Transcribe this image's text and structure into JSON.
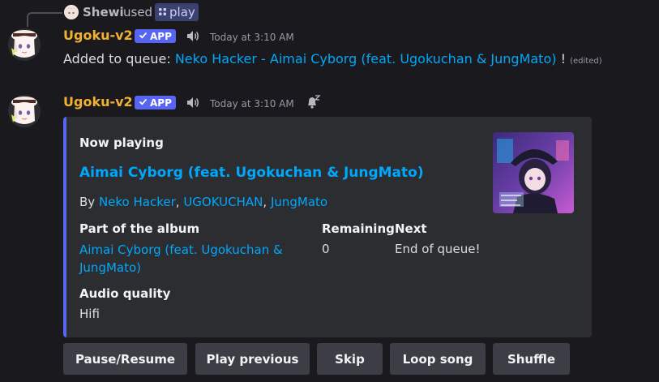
{
  "reply": {
    "user": "Shewi",
    "used_text": "used",
    "command": "play",
    "command_icon": "slash-command-icon"
  },
  "message1": {
    "author": "Ugoku-v2",
    "badge": "APP",
    "timestamp": "Today at 3:10 AM",
    "text_prefix": "Added to queue:",
    "track_link": "Neko Hacker - Aimai Cyborg (feat. Ugokuchan & JungMato)",
    "text_suffix": "!",
    "edited": "(edited)"
  },
  "message2": {
    "author": "Ugoku-v2",
    "badge": "APP",
    "timestamp": "Today at 3:10 AM",
    "embed": {
      "accent_color": "#5865f2",
      "heading": "Now playing",
      "title": "Aimai Cyborg (feat. Ugokuchan & JungMato)",
      "by_label": "By",
      "artists": [
        "Neko Hacker",
        "UGOKUCHAN",
        "JungMato"
      ],
      "separator": ",",
      "fields": {
        "album_title": "Part of the album",
        "album_line1": "Aimai Cyborg (feat. Ugokuchan &",
        "album_line2": "JungMato)",
        "remaining_title": "Remaining",
        "remaining_value": "0",
        "next_title": "Next",
        "next_value": "End of queue!",
        "quality_title": "Audio quality",
        "quality_value": "Hifi"
      }
    }
  },
  "buttons": {
    "pause": "Pause/Resume",
    "previous": "Play previous",
    "skip": "Skip",
    "loop": "Loop song",
    "shuffle": "Shuffle"
  },
  "colors": {
    "background": "#1a1a1e",
    "bot_name": "#f0b132",
    "link": "#00a8fc",
    "app_badge": "#5865f2",
    "button": "#3c3d45"
  }
}
